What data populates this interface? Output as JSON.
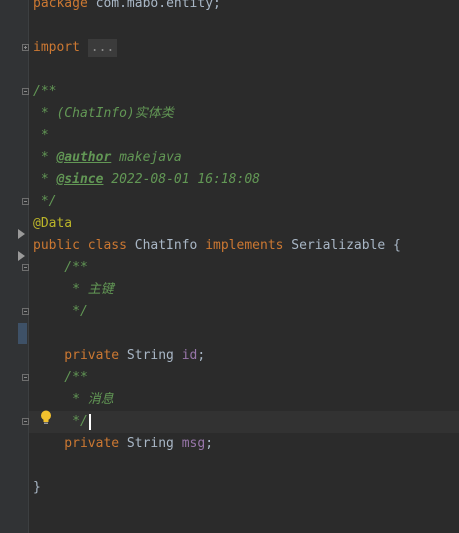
{
  "code": {
    "line1": {
      "kw": "package",
      "text": " com.mabo.entity;"
    },
    "line2": {
      "kw": "import",
      "folded": "..."
    },
    "line3": {
      "doc": "/**"
    },
    "line4": {
      "doc": " * (ChatInfo)实体类"
    },
    "line5": {
      "doc": " *"
    },
    "line6": {
      "prefix": " * ",
      "tag": "@author",
      "value": " makejava"
    },
    "line7": {
      "prefix": " * ",
      "tag": "@since",
      "value": " 2022-08-01 16:18:08"
    },
    "line8": {
      "doc": " */"
    },
    "line9": {
      "ann": "@Data"
    },
    "line10": {
      "kw1": "public class ",
      "name": "ChatInfo ",
      "kw2": "implements ",
      "iface": "Serializable {"
    },
    "line11": {
      "doc": "    /**"
    },
    "line12": {
      "doc": "     * 主键"
    },
    "line13": {
      "doc": "     */"
    },
    "line14": {
      "kw": "    private ",
      "type": "String ",
      "field": "id",
      "end": ";"
    },
    "line15": {
      "doc": "    /**"
    },
    "line16": {
      "doc": "     * 消息"
    },
    "line17": {
      "doc": "     */"
    },
    "line18": {
      "kw": "    private ",
      "type": "String ",
      "field": "msg",
      "end": ";"
    },
    "line19": {
      "text": "}"
    }
  },
  "icons": {
    "fold": "fold-icon",
    "arrow": "play-arrow-icon",
    "bulb": "lightbulb-icon"
  },
  "colors": {
    "background": "#2b2b2b",
    "keyword": "#cc7832",
    "annotation": "#bbb529",
    "doc_comment": "#629755",
    "field": "#9876aa",
    "text": "#a9b7c6"
  }
}
